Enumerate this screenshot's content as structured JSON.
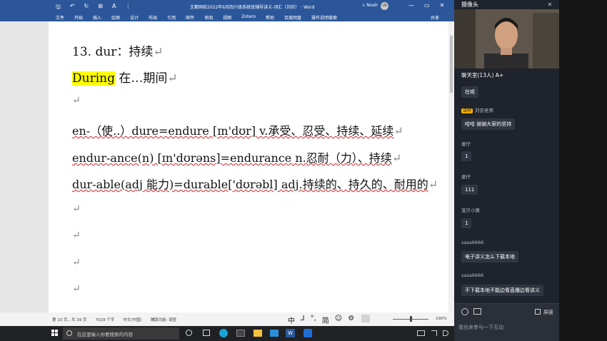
{
  "word": {
    "quick_access": [
      "🖫",
      "↶",
      "↻",
      "⊞",
      "A",
      "⋮"
    ],
    "title": "文都网校2022年6月四六级系统班辅导讲义-词汇（刘农） · Word",
    "user": "L Noah",
    "avatar_initials": "LN",
    "window_buttons": [
      "—",
      "▭",
      "✕"
    ],
    "ribbon_tabs": [
      "文件",
      "开始",
      "插入",
      "绘图",
      "设计",
      "布局",
      "引用",
      "邮件",
      "审阅",
      "视图",
      "Zotero",
      "帮助",
      "百度网盘",
      "操作说明搜索"
    ],
    "share": "共享",
    "doc_lines": [
      {
        "text": "13. dur：持续",
        "mark": "↵"
      },
      {
        "highlight": "During",
        "text": " 在…期间",
        "mark": "↵"
      },
      {
        "text": "",
        "mark": "↵"
      },
      {
        "text": "en-（使..）dure=endure [ɪn'dʊr] v.承受、忍受、持续、延续",
        "mark": "↵"
      },
      {
        "text": "endur-ance(n)  [ɪn'dʊrəns]=endurance n.忍耐（力）、持续",
        "mark": "↵"
      },
      {
        "text": "dur-able(adj 能力)=durable['dʊrəbl] adj.持续的、持久的、耐用的",
        "mark": "↵"
      },
      {
        "text": "",
        "mark": "↵"
      },
      {
        "text": "",
        "mark": "↵"
      },
      {
        "text": "",
        "mark": "↵"
      },
      {
        "text": "",
        "mark": "↵"
      }
    ],
    "status": {
      "page": "第 10 页，共 39 页",
      "words": "7029 个字",
      "lang": "中文(中国)",
      "accessibility": "辅助功能: 调查",
      "ime": [
        "中",
        "⅃",
        "°,",
        "简",
        "☺",
        "⚙"
      ],
      "zoom": "190%"
    }
  },
  "taskbar": {
    "start_icon": "windows-start",
    "search_placeholder": "在这里输入你要搜索的内容"
  },
  "panel": {
    "video_title": "摄像头",
    "chat_title": "聊天室(13人)",
    "font_button": "A+",
    "messages": [
      {
        "name": "",
        "text": "在呢"
      },
      {
        "tag": "讲师",
        "name": "刘农老师",
        "text": "哈哈  谢谢大家的坚持"
      },
      {
        "name": "娄仔",
        "text": "1"
      },
      {
        "name": "娄仔",
        "text": "111"
      },
      {
        "name": "宝贝小黄",
        "text": "1"
      },
      {
        "name": "sasa6666",
        "text": "电子讲义怎么下载本地"
      },
      {
        "name": "sasa6666",
        "text": "不下载本地不能边看直播边看讲义"
      }
    ],
    "block_label": "屏蔽",
    "input_placeholder": "我也来参与一下互动"
  }
}
